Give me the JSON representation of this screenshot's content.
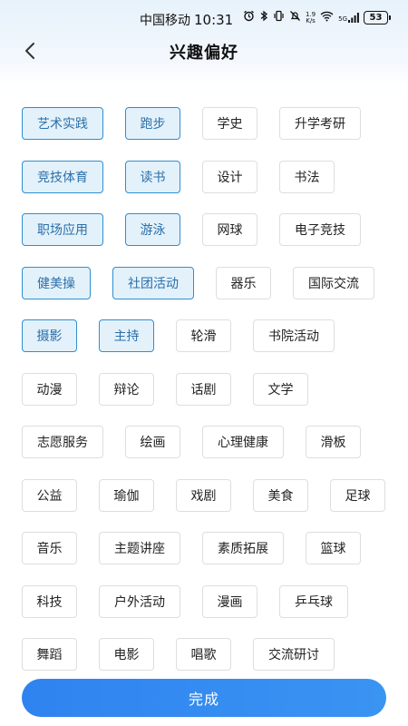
{
  "status_bar": {
    "carrier": "中国移动",
    "time": "10:31",
    "net_speed_value": "1.9",
    "net_speed_unit": "K/s",
    "signal_label": "5G",
    "battery": "53"
  },
  "header": {
    "title": "兴趣偏好",
    "back_icon": "chevron-left-icon"
  },
  "accent_color": "#2f8fd0",
  "tags": [
    [
      {
        "label": "艺术实践",
        "selected": true
      },
      {
        "label": "跑步",
        "selected": true
      },
      {
        "label": "学史",
        "selected": false
      },
      {
        "label": "升学考研",
        "selected": false
      }
    ],
    [
      {
        "label": "竞技体育",
        "selected": true
      },
      {
        "label": "读书",
        "selected": true
      },
      {
        "label": "设计",
        "selected": false
      },
      {
        "label": "书法",
        "selected": false
      }
    ],
    [
      {
        "label": "职场应用",
        "selected": true
      },
      {
        "label": "游泳",
        "selected": true
      },
      {
        "label": "网球",
        "selected": false
      },
      {
        "label": "电子竞技",
        "selected": false
      }
    ],
    [
      {
        "label": "健美操",
        "selected": true
      },
      {
        "label": "社团活动",
        "selected": true
      },
      {
        "label": "器乐",
        "selected": false
      },
      {
        "label": "国际交流",
        "selected": false
      }
    ],
    [
      {
        "label": "摄影",
        "selected": true
      },
      {
        "label": "主持",
        "selected": true
      },
      {
        "label": "轮滑",
        "selected": false
      },
      {
        "label": "书院活动",
        "selected": false
      }
    ],
    [
      {
        "label": "动漫",
        "selected": false
      },
      {
        "label": "辩论",
        "selected": false
      },
      {
        "label": "话剧",
        "selected": false
      },
      {
        "label": "文学",
        "selected": false
      }
    ],
    [
      {
        "label": "志愿服务",
        "selected": false
      },
      {
        "label": "绘画",
        "selected": false
      },
      {
        "label": "心理健康",
        "selected": false
      },
      {
        "label": "滑板",
        "selected": false
      }
    ],
    [
      {
        "label": "公益",
        "selected": false
      },
      {
        "label": "瑜伽",
        "selected": false
      },
      {
        "label": "戏剧",
        "selected": false
      },
      {
        "label": "美食",
        "selected": false
      },
      {
        "label": "足球",
        "selected": false
      }
    ],
    [
      {
        "label": "音乐",
        "selected": false
      },
      {
        "label": "主题讲座",
        "selected": false
      },
      {
        "label": "素质拓展",
        "selected": false
      },
      {
        "label": "篮球",
        "selected": false
      }
    ],
    [
      {
        "label": "科技",
        "selected": false
      },
      {
        "label": "户外活动",
        "selected": false
      },
      {
        "label": "漫画",
        "selected": false
      },
      {
        "label": "乒乓球",
        "selected": false
      }
    ],
    [
      {
        "label": "舞蹈",
        "selected": false
      },
      {
        "label": "电影",
        "selected": false
      },
      {
        "label": "唱歌",
        "selected": false
      },
      {
        "label": "交流研讨",
        "selected": false
      }
    ]
  ],
  "footer": {
    "done_label": "完成"
  }
}
